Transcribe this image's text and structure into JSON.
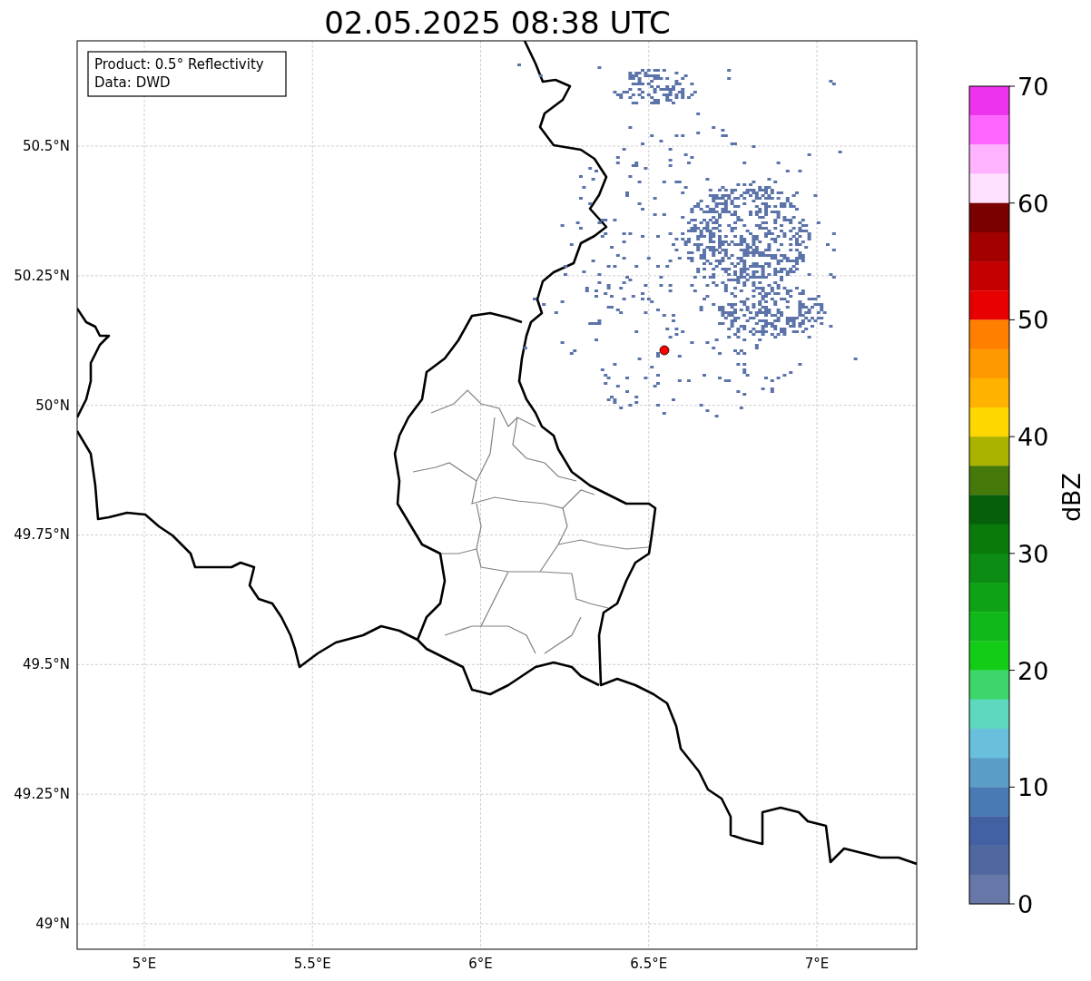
{
  "title": "02.05.2025 08:38 UTC",
  "info_box": [
    "Product: 0.5° Reflectivity",
    "Data: DWD"
  ],
  "map": {
    "xticks": [
      "5°E",
      "5.5°E",
      "6°E",
      "6.5°E",
      "7°E"
    ],
    "yticks": [
      "50.5°N",
      "50.25°N",
      "50°N",
      "49.75°N",
      "49.5°N",
      "49.25°N",
      "49°N"
    ]
  },
  "colorbar": {
    "label": "dBZ",
    "ticks": [
      "70",
      "60",
      "50",
      "40",
      "30",
      "20",
      "10",
      "0"
    ],
    "segments": [
      {
        "color": "#ee33ee"
      },
      {
        "color": "#ff66ff"
      },
      {
        "color": "#ffb3ff"
      },
      {
        "color": "#ffe0ff"
      },
      {
        "color": "#7a0000"
      },
      {
        "color": "#a30000"
      },
      {
        "color": "#c40000"
      },
      {
        "color": "#e60000"
      },
      {
        "color": "#ff7f00"
      },
      {
        "color": "#ff9900"
      },
      {
        "color": "#ffb300"
      },
      {
        "color": "#ffd700"
      },
      {
        "color": "#aab300"
      },
      {
        "color": "#457a0a"
      },
      {
        "color": "#06600a"
      },
      {
        "color": "#0a7a0a"
      },
      {
        "color": "#0c8c12"
      },
      {
        "color": "#0ea314"
      },
      {
        "color": "#10b81a"
      },
      {
        "color": "#12cc18"
      },
      {
        "color": "#3dd66b"
      },
      {
        "color": "#5fd8c0"
      },
      {
        "color": "#68c0dc"
      },
      {
        "color": "#5a9ec8"
      },
      {
        "color": "#4a7ab3"
      },
      {
        "color": "#4360a3"
      },
      {
        "color": "#50689f"
      },
      {
        "color": "#6677a8"
      }
    ]
  }
}
